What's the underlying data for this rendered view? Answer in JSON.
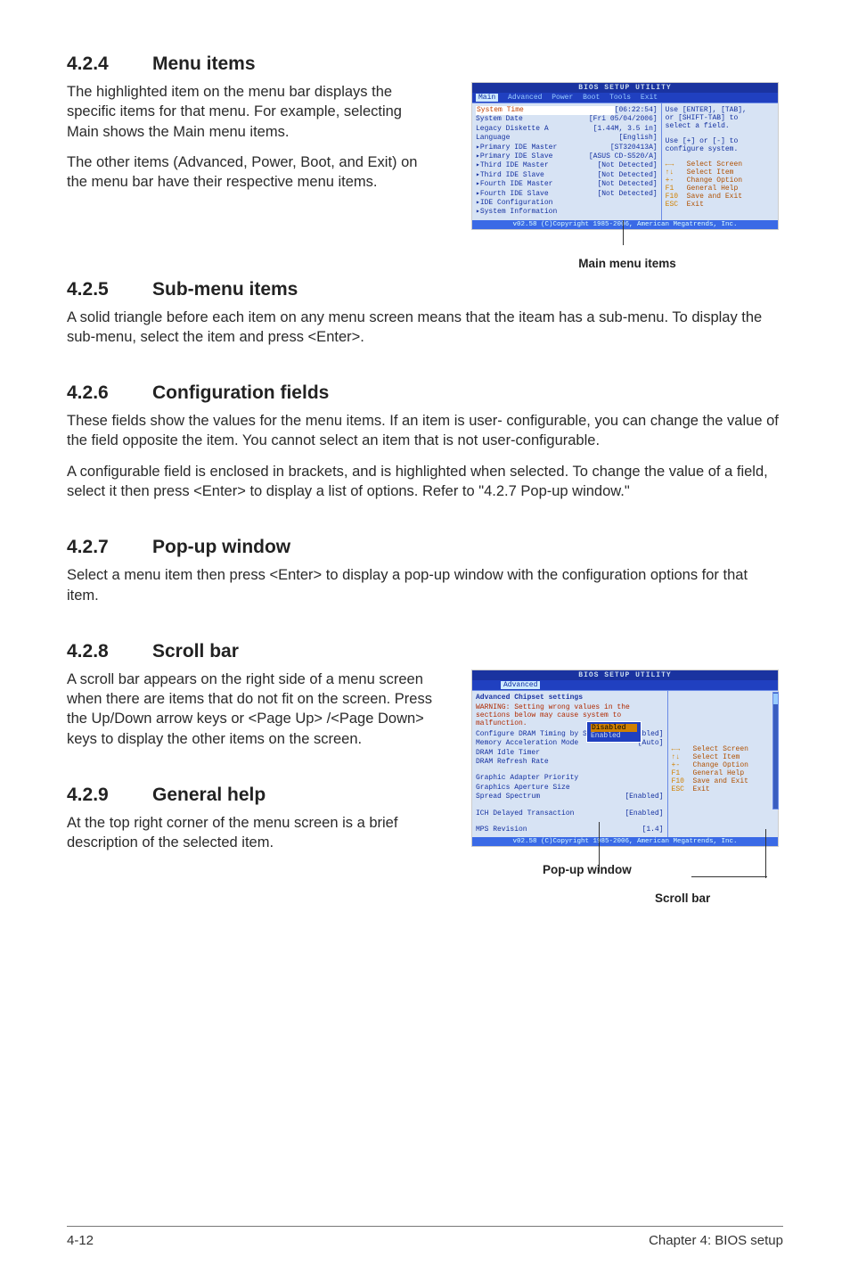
{
  "sections": {
    "s424": {
      "num": "4.2.4",
      "title": "Menu items",
      "p1": "The highlighted item on the menu bar displays the specific items for that menu. For example, selecting Main shows the Main menu items.",
      "p2": "The other items (Advanced, Power, Boot, and Exit) on the menu bar have their respective menu items."
    },
    "s425": {
      "num": "4.2.5",
      "title": "Sub-menu items",
      "p1": "A solid triangle before each item on any menu screen means that the iteam has a sub-menu. To display the sub-menu, select the item and press <Enter>."
    },
    "s426": {
      "num": "4.2.6",
      "title": "Configuration fields",
      "p1": "These fields show the values for the menu items. If an item is user- configurable, you can change the value of the field opposite the item. You cannot select an item that is not user-configurable.",
      "p2": "A configurable field is enclosed in brackets, and is highlighted when selected. To change the value of a field, select it then press <Enter> to display a list of options. Refer to \"4.2.7 Pop-up window.\""
    },
    "s427": {
      "num": "4.2.7",
      "title": "Pop-up window",
      "p1": "Select a menu item then press <Enter> to display a pop-up window with the configuration options for that item."
    },
    "s428": {
      "num": "4.2.8",
      "title": "Scroll bar",
      "p1": "A scroll bar appears on the right side of a menu screen when there are items that do not fit on the screen. Press the Up/Down arrow keys or <Page Up> /<Page Down> keys to display the other items on the screen."
    },
    "s429": {
      "num": "4.2.9",
      "title": "General help",
      "p1": "At the top right corner of the menu screen is a brief description of the selected item."
    }
  },
  "fig1": {
    "titlebar": "BIOS SETUP UTILITY",
    "tabs": {
      "main": "Main",
      "advanced": "Advanced",
      "power": "Power",
      "boot": "Boot",
      "tools": "Tools",
      "exit": "Exit"
    },
    "rows": {
      "r0": {
        "lab": "System Time",
        "val": "[06:22:54]"
      },
      "r1": {
        "lab": "System Date",
        "val": "[Fri 05/04/2006]"
      },
      "r2": {
        "lab": "Legacy Diskette A",
        "val": "[1.44M, 3.5 in]"
      },
      "r3": {
        "lab": "Language",
        "val": "[English]"
      },
      "r4": {
        "lab": "Primary IDE Master",
        "val": "[ST320413A]"
      },
      "r5": {
        "lab": "Primary IDE Slave",
        "val": "[ASUS CD-S520/A]"
      },
      "r6": {
        "lab": "Third IDE Master",
        "val": "[Not Detected]"
      },
      "r7": {
        "lab": "Third IDE Slave",
        "val": "[Not Detected]"
      },
      "r8": {
        "lab": "Fourth IDE Master",
        "val": "[Not Detected]"
      },
      "r9": {
        "lab": "Fourth IDE Slave",
        "val": "[Not Detected]"
      },
      "r10": {
        "lab": "IDE Configuration"
      },
      "r11": {
        "lab": "System Information"
      }
    },
    "help": {
      "h1": "Use [ENTER], [TAB],",
      "h2": "or [SHIFT-TAB] to",
      "h3": "select a field.",
      "h4": "Use [+] or [-] to",
      "h5": "configure system.",
      "keys": {
        "k0": {
          "k": "←→",
          "t": "Select Screen"
        },
        "k1": {
          "k": "↑↓",
          "t": "Select Item"
        },
        "k2": {
          "k": "+-",
          "t": "Change Option"
        },
        "k3": {
          "k": "F1",
          "t": "General Help"
        },
        "k4": {
          "k": "F10",
          "t": "Save and Exit"
        },
        "k5": {
          "k": "ESC",
          "t": "Exit"
        }
      }
    },
    "footer": "v02.58 (C)Copyright 1985-2006, American Megatrends, Inc.",
    "label": "Main menu items"
  },
  "fig2": {
    "titlebar": "BIOS SETUP UTILITY",
    "tab": "Advanced",
    "head": "Advanced Chipset settings",
    "warn": "WARNING: Setting wrong values in the sections below may cause system to malfunction.",
    "rows": {
      "r0": {
        "lab": "Configure DRAM Timing by SPD",
        "val": "[Enabled]"
      },
      "r1": {
        "lab": "Memory Acceleration Mode",
        "val": "[Auto]"
      },
      "r2": {
        "lab": "DRAM Idle Timer",
        "val": ""
      },
      "r3": {
        "lab": "DRAM Refresh Rate",
        "val": ""
      },
      "r4": {
        "lab": "Graphic Adapter Priority",
        "val": ""
      },
      "r5": {
        "lab": "Graphics Aperture Size",
        "val": ""
      },
      "r6": {
        "lab": "Spread Spectrum",
        "val": "[Enabled]"
      },
      "r7": {
        "lab": "ICH Delayed Transaction",
        "val": "[Enabled]"
      },
      "r8": {
        "lab": "MPS Revision",
        "val": "[1.4]"
      }
    },
    "popup": {
      "opt1": "Disabled",
      "opt2": "Enabled"
    },
    "help": {
      "keys": {
        "k0": {
          "k": "←→",
          "t": "Select Screen"
        },
        "k1": {
          "k": "↑↓",
          "t": "Select Item"
        },
        "k2": {
          "k": "+-",
          "t": "Change Option"
        },
        "k3": {
          "k": "F1",
          "t": "General Help"
        },
        "k4": {
          "k": "F10",
          "t": "Save and Exit"
        },
        "k5": {
          "k": "ESC",
          "t": "Exit"
        }
      }
    },
    "footer": "v02.58 (C)Copyright 1985-2006, American Megatrends, Inc.",
    "label_popup": "Pop-up window",
    "label_scroll": "Scroll bar"
  },
  "page_footer": {
    "left": "4-12",
    "right": "Chapter 4: BIOS setup"
  }
}
